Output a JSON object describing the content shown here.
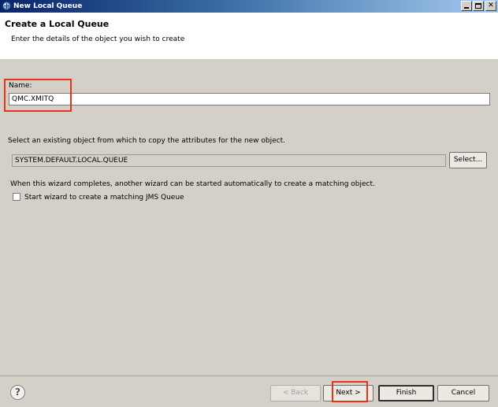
{
  "window": {
    "title": "New Local Queue",
    "icon": "globe-icon"
  },
  "header": {
    "title": "Create a Local Queue",
    "description": "Enter the details of the object you wish to create"
  },
  "name_field": {
    "label": "Name:",
    "value": "QMC.XMITQ"
  },
  "copy_section": {
    "label": "Select an existing object from which to copy the attributes for the new object.",
    "value": "SYSTEM.DEFAULT.LOCAL.QUEUE",
    "select_label": "Select..."
  },
  "wizard_section": {
    "info": "When this wizard completes, another wizard can be started automatically to create a matching object.",
    "checkbox_label": "Start wizard to create a matching JMS Queue",
    "checked": false
  },
  "footer": {
    "help_icon": "?",
    "back_label": "< Back",
    "next_label": "Next >",
    "finish_label": "Finish",
    "cancel_label": "Cancel"
  },
  "colors": {
    "highlight": "#e8331c",
    "titlebar": "#0a246a",
    "dialog": "#d4d0c8"
  }
}
